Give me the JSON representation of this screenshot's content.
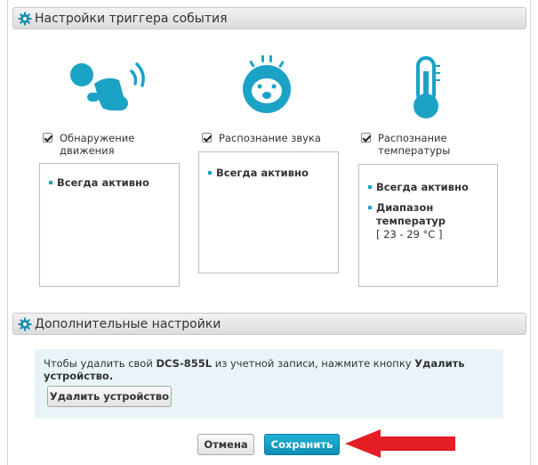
{
  "trigger_section": {
    "title": "Настройки триггера события"
  },
  "triggers": [
    {
      "label_line1": "Обнаружение",
      "label_line2": "движения",
      "items": [
        "Всегда активно"
      ]
    },
    {
      "label_line1": "Распознание звука",
      "label_line2": "",
      "items": [
        "Всегда активно"
      ]
    },
    {
      "label_line1": "Распознание",
      "label_line2": "температуры",
      "items": [
        "Всегда активно",
        "Диапазон температур"
      ],
      "range": "[ 23 - 29 °C ]"
    }
  ],
  "additional_section": {
    "title": "Дополнительные настройки"
  },
  "info": {
    "text_before": "Чтобы удалить свой ",
    "model": "DCS-855L",
    "text_middle": " из учетной записи, нажмите кнопку ",
    "button_ref": "Удалить устройство",
    "text_after": "."
  },
  "buttons": {
    "delete": "Удалить устройство",
    "cancel": "Отмена",
    "save": "Сохранить"
  },
  "colors": {
    "accent": "#1ba3c6",
    "icon": "#1ba3c6",
    "arrow": "#e31e24",
    "info_bg": "#e8f4f7"
  }
}
